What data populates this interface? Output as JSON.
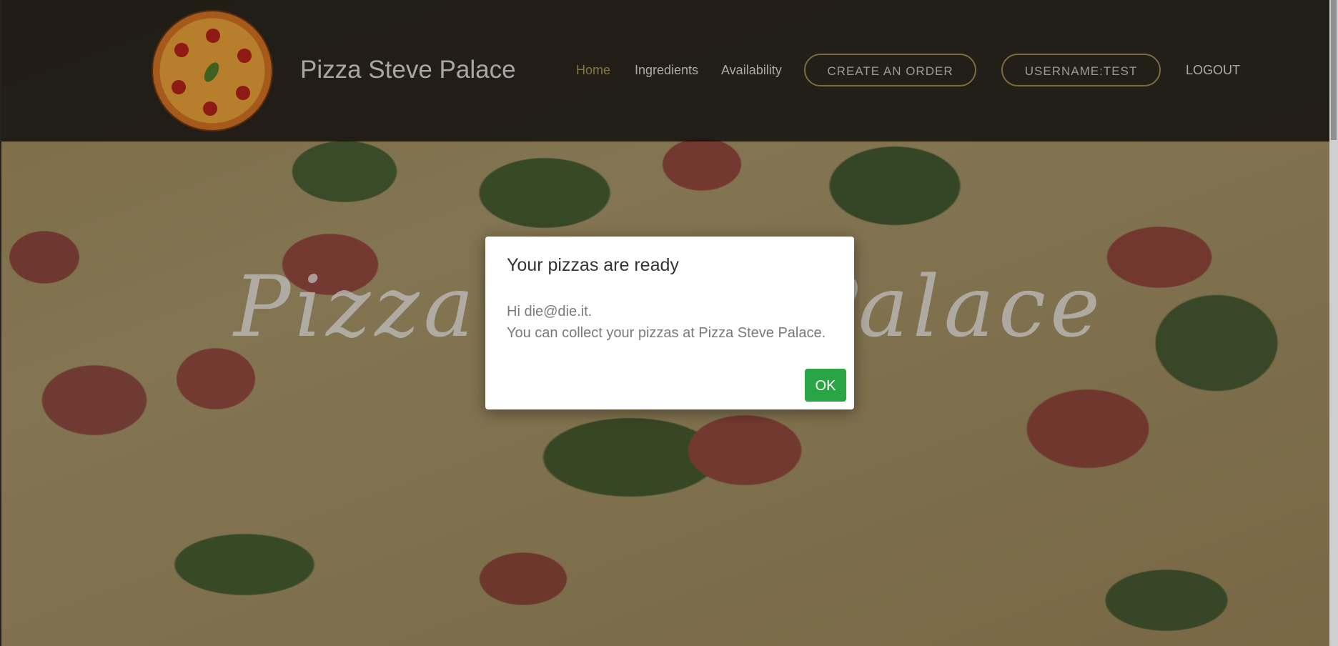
{
  "header": {
    "brand": "Pizza Steve Palace",
    "nav": {
      "home": "Home",
      "ingredients": "Ingredients",
      "availability": "Availability"
    },
    "create_order": "CREATE AN ORDER",
    "username": "USERNAME:TEST",
    "logout": "LOGOUT"
  },
  "hero": {
    "title": "Pizza Steve Palace"
  },
  "modal": {
    "title": "Your pizzas are ready",
    "line1": "Hi die@die.it.",
    "line2": "You can collect your pizzas at Pizza Steve Palace.",
    "ok": "OK"
  },
  "colors": {
    "accent": "#8a7446",
    "ok_button": "#2aa545"
  }
}
